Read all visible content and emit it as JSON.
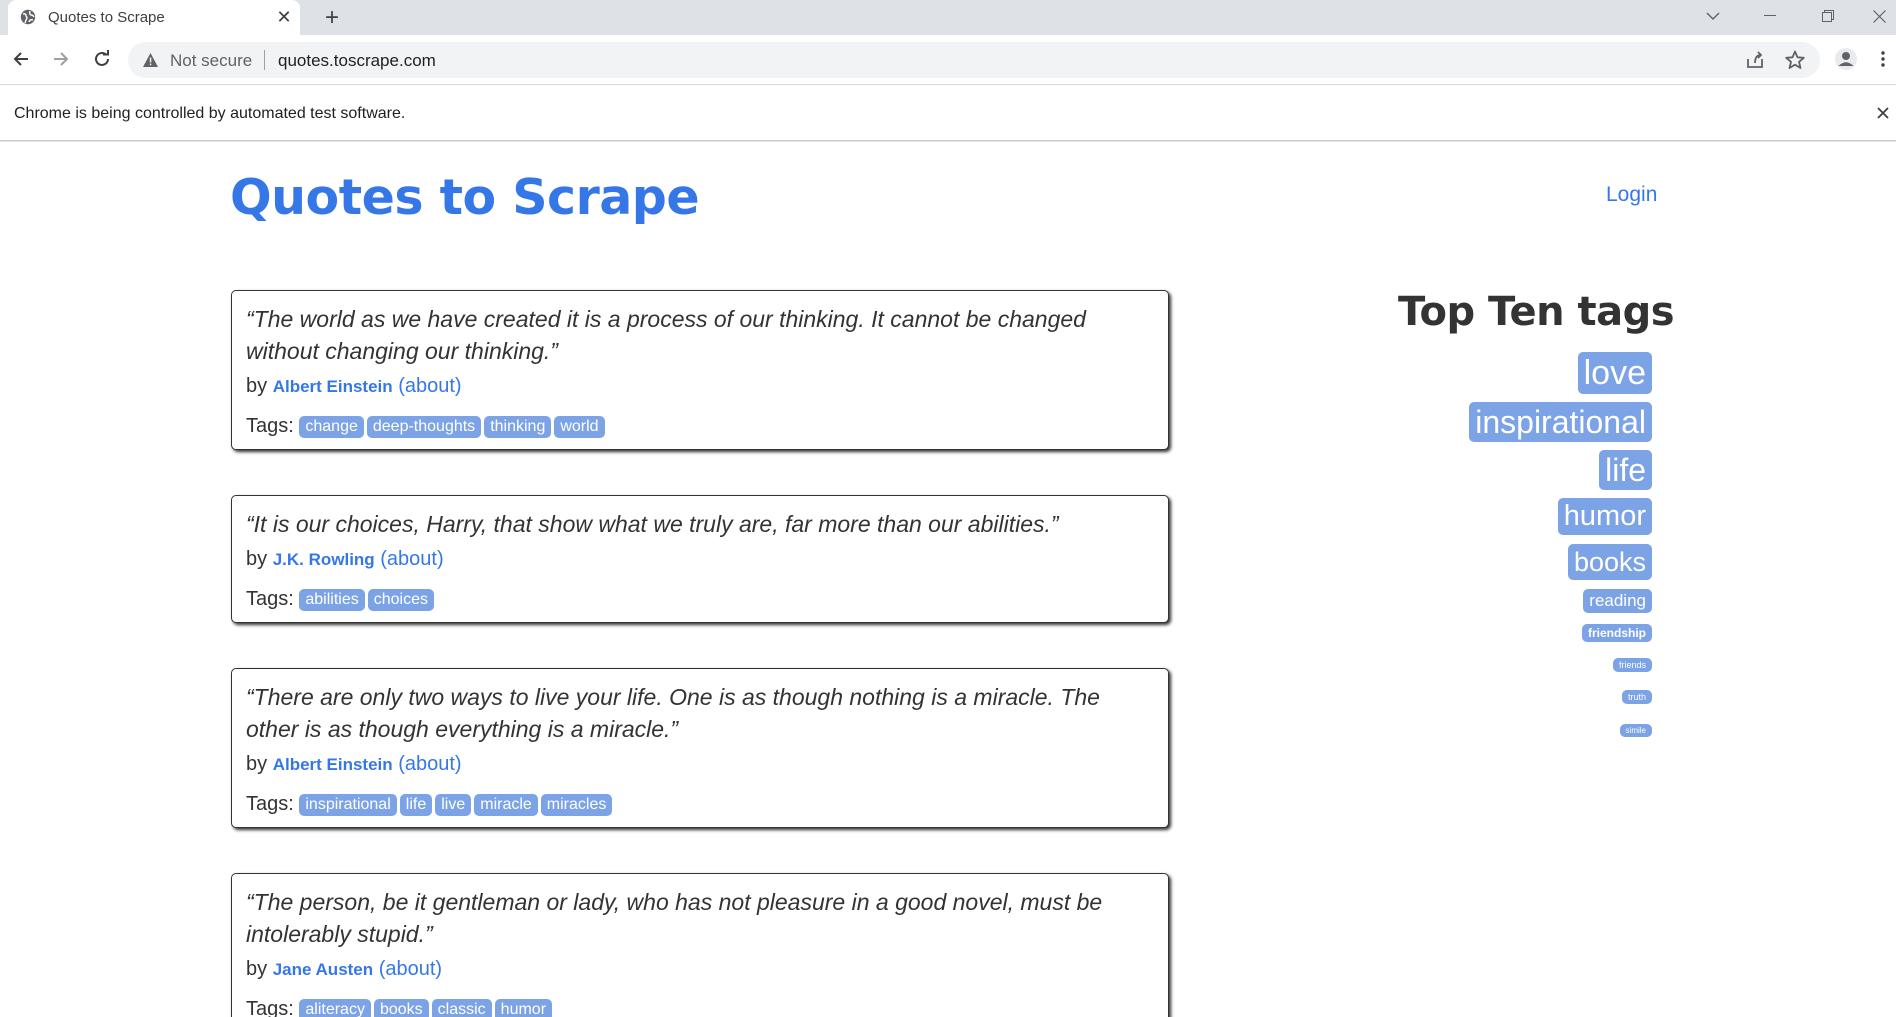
{
  "browser": {
    "tab_title": "Quotes to Scrape",
    "security_label": "Not secure",
    "url": "quotes.toscrape.com",
    "infobar_text": "Chrome is being controlled by automated test software."
  },
  "site": {
    "title": "Quotes to Scrape",
    "login_label": "Login"
  },
  "quotes": [
    {
      "text": "“The world as we have created it is a process of our thinking. It cannot be changed without changing our thinking.”",
      "by_label": "by",
      "author": "Albert Einstein",
      "about_label": "(about)",
      "tags_label": "Tags:",
      "tags": [
        "change",
        "deep-thoughts",
        "thinking",
        "world"
      ]
    },
    {
      "text": "“It is our choices, Harry, that show what we truly are, far more than our abilities.”",
      "by_label": "by",
      "author": "J.K. Rowling",
      "about_label": "(about)",
      "tags_label": "Tags:",
      "tags": [
        "abilities",
        "choices"
      ]
    },
    {
      "text": "“There are only two ways to live your life. One is as though nothing is a miracle. The other is as though everything is a miracle.”",
      "by_label": "by",
      "author": "Albert Einstein",
      "about_label": "(about)",
      "tags_label": "Tags:",
      "tags": [
        "inspirational",
        "life",
        "live",
        "miracle",
        "miracles"
      ]
    },
    {
      "text": "“The person, be it gentleman or lady, who has not pleasure in a good novel, must be intolerably stupid.”",
      "by_label": "by",
      "author": "Jane Austen",
      "about_label": "(about)",
      "tags_label": "Tags:",
      "tags": [
        "aliteracy",
        "books",
        "classic",
        "humor"
      ]
    }
  ],
  "sidebar": {
    "title": "Top Ten tags",
    "tags": [
      "love",
      "inspirational",
      "life",
      "humor",
      "books",
      "reading",
      "friendship",
      "friends",
      "truth",
      "simile"
    ]
  },
  "colors": {
    "link": "#3677e8",
    "tag_bg": "#7ca3e6",
    "text": "#333333"
  }
}
